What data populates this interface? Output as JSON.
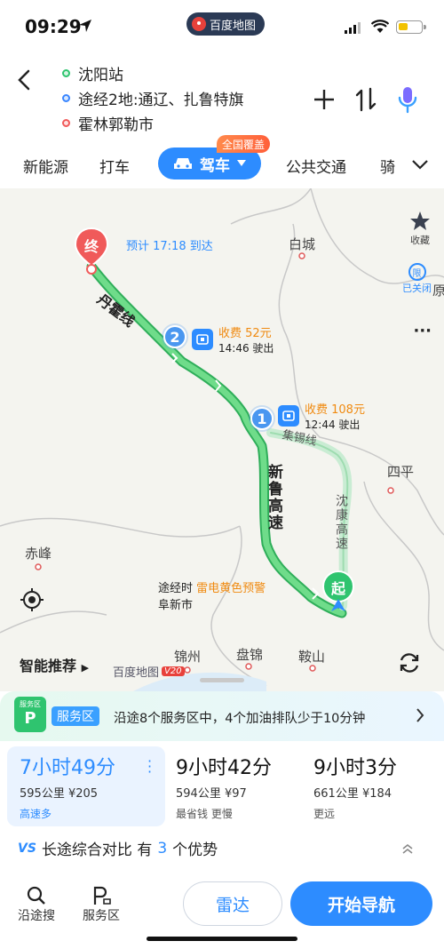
{
  "status_bar": {
    "time": "09:29",
    "app_name": "百度地图",
    "icons": [
      "navigation-arrow-icon",
      "signal-icon",
      "wifi-icon",
      "battery-icon"
    ]
  },
  "route": {
    "start": "沈阳站",
    "via": "途经2地:通辽、扎鲁特旗",
    "end": "霍林郭勒市"
  },
  "header_actions": {
    "icons": [
      "back-icon",
      "add-icon",
      "swap-icon",
      "voice-icon"
    ]
  },
  "modes": {
    "tabs": [
      "新能源",
      "打车",
      "驾车",
      "公共交通",
      "骑"
    ],
    "active": "驾车",
    "badge": "全国覆盖"
  },
  "map": {
    "end_marker": "终",
    "start_marker": "起",
    "eta": "预计 17:18 到达",
    "cities": [
      "白城",
      "四平",
      "赤峰",
      "锦州",
      "盘锦",
      "鞍山",
      "原"
    ],
    "roads": {
      "r1": "丹霍线",
      "r2": "新鲁高速",
      "r3": "沈康高速",
      "r4": "集锡线"
    },
    "tolls": [
      {
        "num": "2",
        "fee": "收费 52元",
        "time": "14:46 驶出"
      },
      {
        "num": "1",
        "fee": "收费 108元",
        "time": "12:44 驶出"
      }
    ],
    "weather": {
      "prefix": "途经时",
      "warning": "雷电黄色预警",
      "city": "阜新市"
    },
    "side_buttons": {
      "favorite": "收藏",
      "limit": "已关闭",
      "limit_char": "限",
      "more": "···"
    },
    "smart_recommend": "智能推荐",
    "logo": "百度地图",
    "logo_version": "V20"
  },
  "service_area": {
    "icon_top": "服务区",
    "tag": "服务区",
    "text": "沿途8个服务区中，4个加油排队少于10分钟"
  },
  "route_options": [
    {
      "duration": "7小时49分",
      "meta": "595公里 ¥205",
      "tag": "高速多",
      "selected": true
    },
    {
      "duration": "9小时42分",
      "meta": "594公里 ¥97",
      "tag": "最省钱 更慢",
      "selected": false
    },
    {
      "duration": "9小时3分",
      "meta": "661公里 ¥184",
      "tag": "更远",
      "selected": false
    }
  ],
  "compare": {
    "vs": "VS",
    "text_pre": "长途综合对比 有",
    "num": "3",
    "text_post": "个优势"
  },
  "bottom_bar": {
    "search_along": "沿途搜",
    "service": "服务区",
    "radar": "雷达",
    "start_nav": "开始导航"
  },
  "colors": {
    "accent": "#2d8cff",
    "route_green": "#5fd37e",
    "warning_orange": "#f08a10",
    "end_red": "#f05a5a"
  }
}
